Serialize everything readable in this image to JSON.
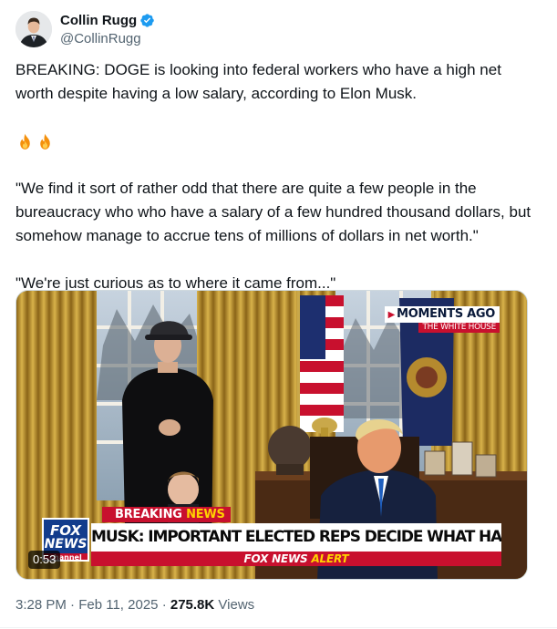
{
  "author": {
    "display_name": "Collin Rugg",
    "handle": "@CollinRugg",
    "verified": true
  },
  "tweet": {
    "paragraph1": "BREAKING: DOGE is looking into federal workers who have a high net worth despite having a low salary, according to Elon Musk.",
    "emoji": [
      "fire-icon",
      "fire-icon"
    ],
    "paragraph2": "\"We find it sort of rather odd that there are quite a few people in the bureaucracy who who have a salary of a few hundred thousand dollars, but somehow manage to accrue tens of millions of dollars in net worth.\"",
    "paragraph3": "\"We're just curious as to where it came from...\""
  },
  "video": {
    "moments_ago": "MOMENTS AGO",
    "location": "THE WHITE HOUSE",
    "breaking_prefix": "BREAKING",
    "breaking_suffix": "NEWS",
    "headline": "MUSK: IMPORTANT ELECTED REPS DECIDE WHAT HAPPENS",
    "alert_prefix": "FOX NEWS",
    "alert_suffix": "ALERT",
    "logo_line1": "FOX",
    "logo_line2": "NEWS",
    "logo_line3": "channel",
    "duration": "0:53"
  },
  "meta": {
    "time": "3:28 PM",
    "date": "Feb 11, 2025",
    "views_count": "275.8K",
    "views_label": "Views",
    "separator": "·"
  },
  "colors": {
    "text_primary": "#0f1419",
    "text_secondary": "#536471",
    "verified_blue": "#1d9bf0",
    "fox_red": "#c8102e",
    "fox_blue": "#123c8c"
  }
}
